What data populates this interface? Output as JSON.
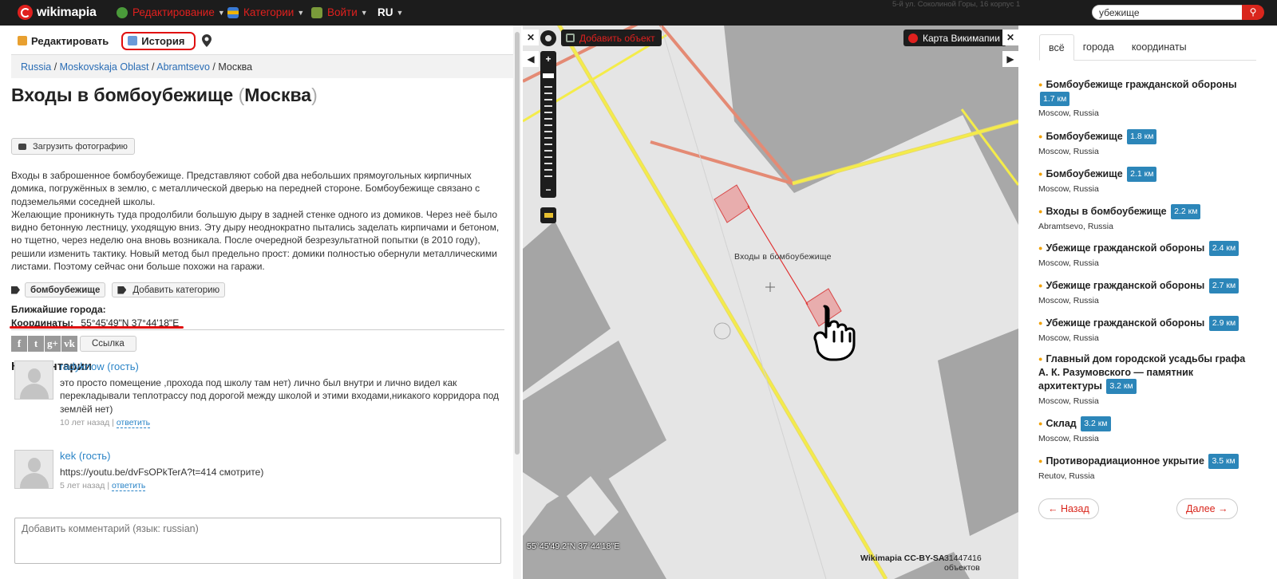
{
  "topbar": {
    "brand": "wikimapia",
    "menu": [
      {
        "label": "Редактирование",
        "icon": "globe-edit-icon"
      },
      {
        "label": "Категории",
        "icon": "categories-icon"
      },
      {
        "label": "Войти",
        "icon": "login-icon"
      }
    ],
    "lang": "RU",
    "search_value": "убежище",
    "search_icon": "search-icon",
    "address": "5-й ул. Соколиной Горы, 16 корпус 1"
  },
  "left": {
    "tabs": {
      "edit": "Редактировать",
      "history": "История"
    },
    "breadcrumb": {
      "c0": "Russia",
      "c1": "Moskovskaja Oblast",
      "c2": "Abramtsevo",
      "current": "Москва"
    },
    "title": "Входы в бомбоубежище",
    "title_city": "Москва",
    "upload_photo": "Загрузить фотографию",
    "description": "Входы в заброшенное бомбоубежище. Представляют собой два небольших прямоугольных кирпичных домика, погружённых в землю, с металлической дверью на передней стороне. Бомбоубежище связано с подземельями соседней школы.\nЖелающие проникнуть туда продолбили большую дыру в задней стенке одного из домиков. Через неё было видно бетонную лестницу, уходящую вниз. Эту дыру неоднократно пытались заделать кирпичами и бетоном, но тщетно, через неделю она вновь возникала. После очередной безрезультатной попытки (в 2010 году), решили изменить тактику. Новый метод был предельно прост: домики полностью обернули металлическими листами. Поэтому сейчас они больше похожи на гаражи.",
    "tag": "бомбоубежище",
    "add_category": "Добавить категорию",
    "nearest_cities_label": "Ближайшие города:",
    "coords_label": "Координаты:",
    "coords_value": "55°45'49\"N 37°44'18\"E",
    "share_link": "Ссылка",
    "comments_heading": "Комментарии",
    "comments": [
      {
        "author": "radyknow (гость)",
        "text": "это просто помещение ,прохода под школу там нет) лично был внутри и лично видел как перекладывали теплотрассу под дорогой между школой и этими входами,никакого корридора под землёй нет)",
        "age": "10 лет назад",
        "reply": "ответить"
      },
      {
        "author": "kek (гость)",
        "text": "https://youtu.be/dvFsOPkTerA?t=414 смотрите)",
        "age": "5 лет назад",
        "reply": "ответить"
      }
    ],
    "comment_placeholder": "Добавить комментарий (язык: russian)"
  },
  "map": {
    "add_object": "Добавить объект",
    "wikimapia_map": "Карта Викимапии",
    "object_label": "Входы в бомбоубежище",
    "coord_readout": "55°45'49.2\"N 37°44'18\"E",
    "credit": "Wikimapia CC-BY-SA",
    "objects_count": "31447416 объектов"
  },
  "right": {
    "tabs": [
      "всё",
      "города",
      "координаты"
    ],
    "results": [
      {
        "title": "Бомбоубежище гражданской обороны",
        "km": "1.7 км",
        "loc": "Moscow, Russia"
      },
      {
        "title": "Бомбоубежище",
        "km": "1.8 км",
        "loc": "Moscow, Russia"
      },
      {
        "title": "Бомбоубежище",
        "km": "2.1 км",
        "loc": "Moscow, Russia"
      },
      {
        "title": "Входы в бомбоубежище",
        "km": "2.2 км",
        "loc": "Abramtsevo, Russia"
      },
      {
        "title": "Убежище гражданской обороны",
        "km": "2.4 км",
        "loc": "Moscow, Russia"
      },
      {
        "title": "Убежище гражданской обороны",
        "km": "2.7 км",
        "loc": "Moscow, Russia"
      },
      {
        "title": "Убежище гражданской обороны",
        "km": "2.9 км",
        "loc": "Moscow, Russia"
      },
      {
        "title": "Главный дом городской усадьбы графа А. К. Разумовского — памятник архитектуры",
        "km": "3.2 км",
        "loc": "Moscow, Russia"
      },
      {
        "title": "Склад",
        "km": "3.2 км",
        "loc": "Moscow, Russia"
      },
      {
        "title": "Противорадиационное укрытие",
        "km": "3.5 км",
        "loc": "Reutov, Russia"
      }
    ],
    "prev": "← Назад",
    "next": "Далее →"
  },
  "colors": {
    "accent_red": "#e0201e",
    "link_blue": "#2a6db5",
    "km_badge": "#2c86b9",
    "topbar_bg": "#1c1c1c"
  }
}
